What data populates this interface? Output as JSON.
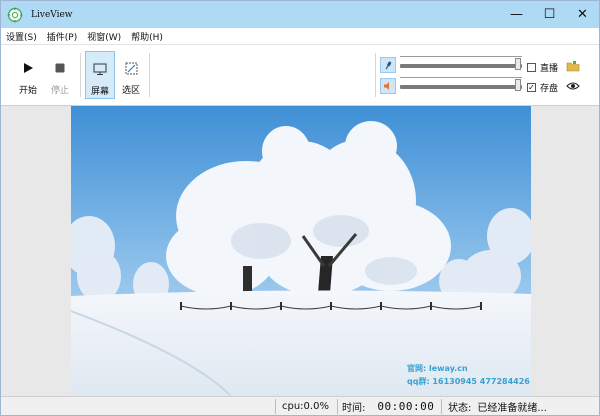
{
  "window": {
    "title": "LiveView"
  },
  "window_controls": {
    "minimize": "—",
    "maximize": "☐",
    "close": "✕"
  },
  "menu": [
    "设置(S)",
    "插件(P)",
    "视窗(W)",
    "帮助(H)"
  ],
  "toolbar": {
    "start_label": "开始",
    "stop_label": "停止",
    "screen_label": "屏幕",
    "region_label": "选区"
  },
  "audio": {
    "mic_level": 0.99,
    "speaker_level": 0.99
  },
  "options": {
    "live_label": "直播",
    "live_checked": false,
    "save_label": "存盘",
    "save_checked": true,
    "save_check_mark": "✓"
  },
  "watermark": {
    "line1": "官网: leway.cn",
    "line2": "qq群: 16130945  477284426"
  },
  "status": {
    "cpu": "cpu:0.0%",
    "time_label": "时间:",
    "time_value": "00:00:00",
    "state_label": "状态:",
    "state_value": "已经准备就绪..."
  },
  "colors": {
    "titlebar": "#aedaf5",
    "accent": "#3aa0cf",
    "sky_top": "#3f8fd6",
    "snow": "#ffffff"
  }
}
